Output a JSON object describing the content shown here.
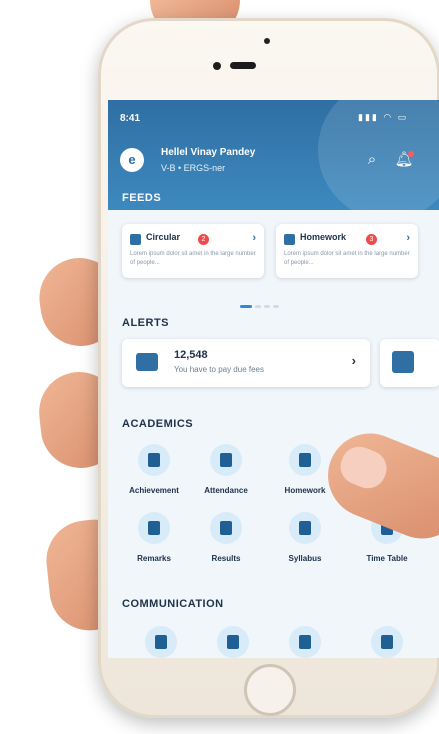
{
  "status_bar": {
    "time": "8:41",
    "icons": "▮▮▮ ◠ ▭"
  },
  "user": {
    "initial": "e",
    "name": "Hellel Vinay Pandey",
    "class_info": "V-B • ERGS-ner"
  },
  "sections": {
    "feeds": "FEEDS",
    "alerts": "ALERTS",
    "academics": "ACADEMICS",
    "communication": "COMMUNICATION"
  },
  "feeds": [
    {
      "title": "Circular",
      "badge": "2",
      "text": "Lorem ipsum dolor sit amet in the large number of people..."
    },
    {
      "title": "Homework",
      "badge": "3",
      "text": "Lorem ipsum dolor sit amet in the large number of people..."
    }
  ],
  "alert": {
    "amount": "12,548",
    "text": "You have to pay due fees",
    "arrow": "›"
  },
  "academics": [
    {
      "label": "Achievement",
      "icon": "trophy-icon"
    },
    {
      "label": "Attendance",
      "icon": "calendar-icon"
    },
    {
      "label": "Homework",
      "icon": "book-icon"
    },
    {
      "label": "Remarks",
      "icon": "remarks-icon"
    },
    {
      "label": "Results",
      "icon": "results-icon"
    },
    {
      "label": "Syllabus",
      "icon": "syllabus-icon"
    },
    {
      "label": "Time Table",
      "icon": "timetable-icon"
    }
  ],
  "communication": [
    {
      "icon": "message-icon"
    },
    {
      "icon": "calendar-icon"
    },
    {
      "icon": "transport-icon"
    },
    {
      "icon": "video-icon"
    }
  ],
  "colors": {
    "header": "#2f6fa3",
    "accent": "#2f89d5",
    "badge": "#f04a4a"
  }
}
